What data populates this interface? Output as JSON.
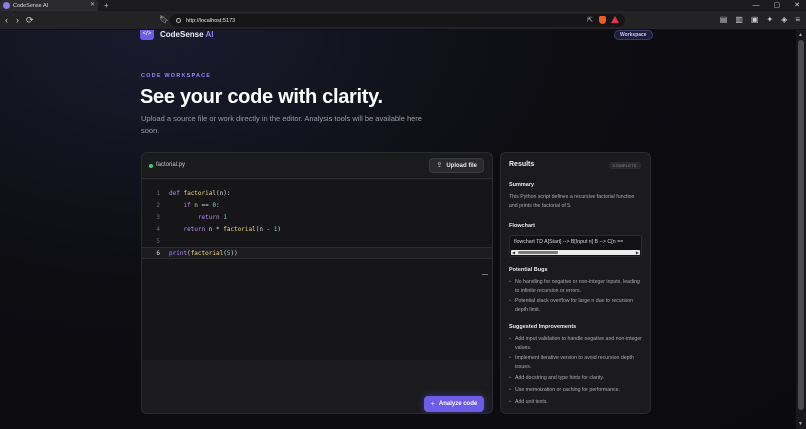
{
  "browser": {
    "tab_title": "CodeSense AI",
    "url": "http://localhost:5173",
    "controls": {
      "minimize": "—",
      "maximize": "▢",
      "close": "✕",
      "new_tab": "+",
      "tab_close": "✕"
    },
    "nav": {
      "back": "‹",
      "forward": "›",
      "reload": "⟳"
    }
  },
  "header": {
    "logo_glyph": "</>",
    "brand_main": "CodeSense",
    "brand_ai": "AI",
    "workspace_pill": "Workspace"
  },
  "hero": {
    "eyebrow": "CODE WORKSPACE",
    "title": "See your code with clarity.",
    "subtitle": "Upload a source file or work directly in the editor. Analysis tools will be available here soon."
  },
  "editor": {
    "file_name": "factorial.py",
    "upload_label": "Upload file",
    "upload_icon": "⇪",
    "analyze_label": "Analyze code",
    "analyze_icon": "+",
    "active_line": 6,
    "lines": [
      {
        "n": "1",
        "text": "def factorial(n):"
      },
      {
        "n": "2",
        "text": "    if n == 0:"
      },
      {
        "n": "3",
        "text": "        return 1"
      },
      {
        "n": "4",
        "text": "    return n * factorial(n - 1)"
      },
      {
        "n": "5",
        "text": ""
      },
      {
        "n": "6",
        "text": "print(factorial(5))"
      }
    ]
  },
  "results": {
    "title": "Results",
    "badge": "COMPLETE",
    "summary_title": "Summary",
    "summary_text": "This Python script defines a recursive factorial function and prints the factorial of 5.",
    "flowchart_title": "Flowchart",
    "flowchart_text": "flowchart TD A[Start] --> B[Input n] B --> C{n ==",
    "bugs_title": "Potential Bugs",
    "bugs": [
      "No handling for negative or non-integer inputs, leading to infinite recursion or errors.",
      "Potential stack overflow for large n due to recursion depth limit."
    ],
    "improvements_title": "Suggested Improvements",
    "improvements": [
      "Add input validation to handle negative and non-integer values.",
      "Implement iterative version to avoid recursion depth issues.",
      "Add docstring and type hints for clarity.",
      "Use memoization or caching for performance.",
      "Add unit tests."
    ]
  },
  "colors": {
    "accent": "#6c5ce7",
    "accent_text": "#8f86ff",
    "background": "#0b0b0f",
    "card": "#1b1b1e",
    "file_status": "#3ccf7b"
  }
}
